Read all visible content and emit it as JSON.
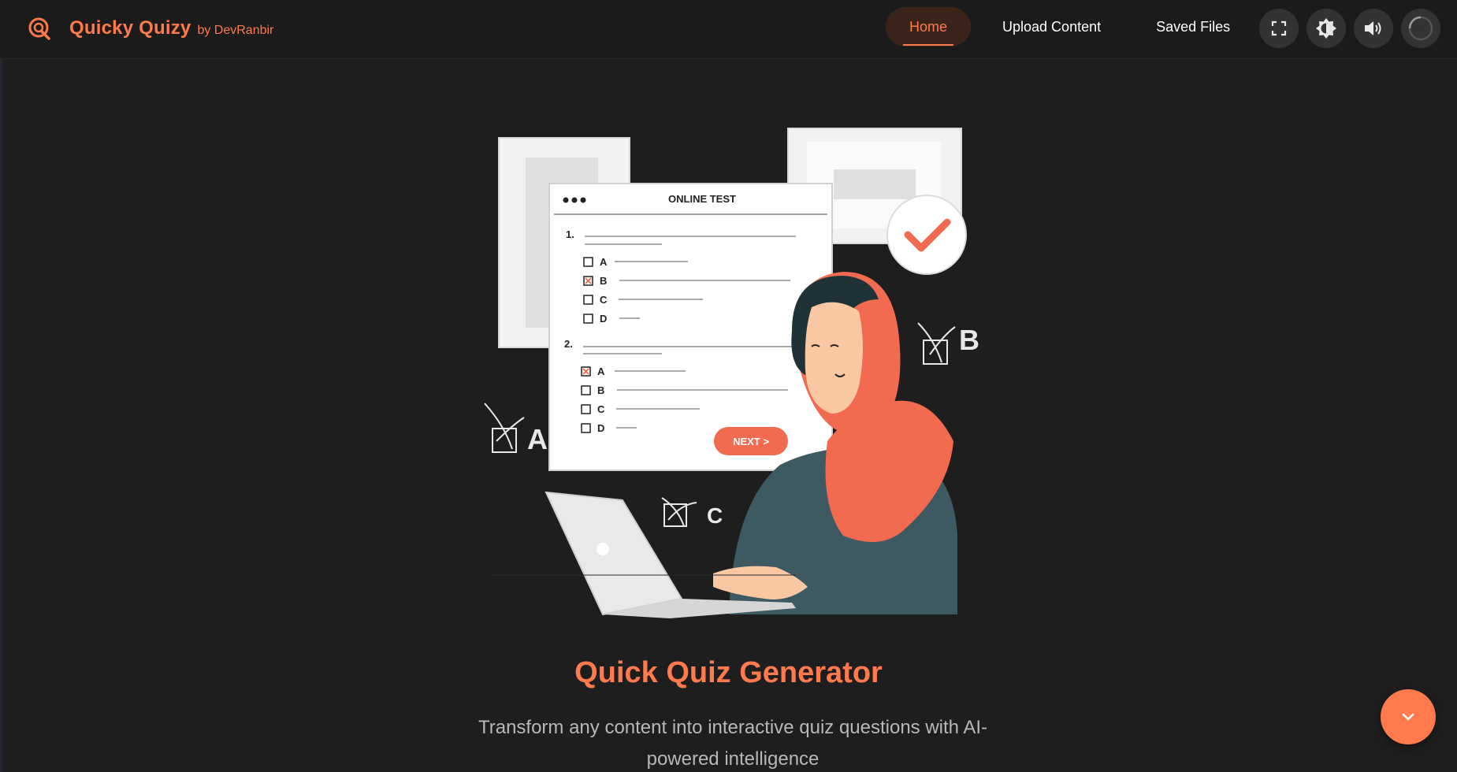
{
  "brand": {
    "title": "Quicky Quizy",
    "by": "by DevRanbir",
    "logo_icon": "q-logo-icon",
    "accent_color": "#ff7a4d"
  },
  "nav": {
    "items": [
      {
        "label": "Home",
        "active": true
      },
      {
        "label": "Upload Content",
        "active": false
      },
      {
        "label": "Saved Files",
        "active": false
      }
    ],
    "icons": [
      "fullscreen-icon",
      "brightness-icon",
      "volume-icon",
      "loading-spinner-icon"
    ]
  },
  "illustration": {
    "panel_title": "ONLINE TEST",
    "q1_number": "1.",
    "q2_number": "2.",
    "options": [
      "A",
      "B",
      "C",
      "D"
    ],
    "next_button": "NEXT >",
    "floating_letters": [
      "A",
      "B",
      "C"
    ]
  },
  "hero": {
    "title": "Quick Quiz Generator",
    "subtitle": "Transform any content into interactive quiz questions with AI-powered intelligence"
  },
  "scroll_button": {
    "icon": "chevron-down-icon"
  }
}
